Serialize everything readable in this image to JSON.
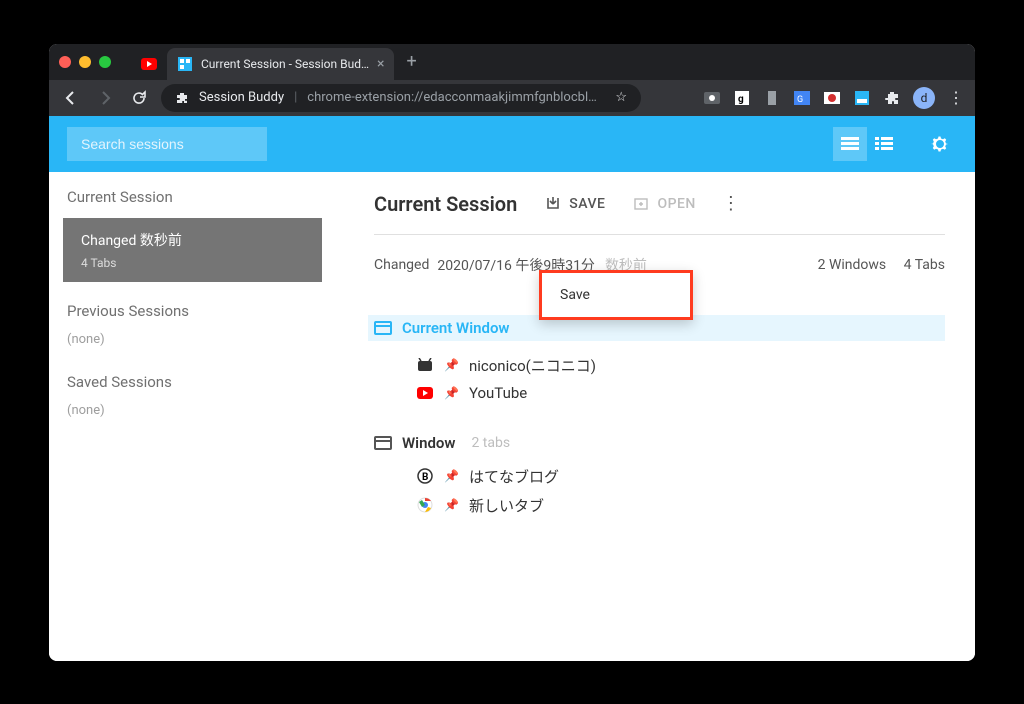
{
  "browser": {
    "tabs": [
      {
        "title": "",
        "icon": "youtube"
      },
      {
        "title": "Current Session - Session Bud…",
        "icon": "sessionbuddy",
        "active": true
      }
    ],
    "url_title": "Session Buddy",
    "url_path": "chrome-extension://edacconmaakjimmfgnblocbl…",
    "avatar_letter": "d"
  },
  "topbar": {
    "search_placeholder": "Search sessions"
  },
  "sidebar": {
    "current_heading": "Current Session",
    "current_item": {
      "line1": "Changed 数秒前",
      "line2": "4 Tabs"
    },
    "previous_heading": "Previous Sessions",
    "previous_none": "(none)",
    "saved_heading": "Saved Sessions",
    "saved_none": "(none)"
  },
  "main": {
    "title": "Current Session",
    "save_label": "SAVE",
    "open_label": "OPEN",
    "changed_label": "Changed",
    "changed_date": "2020/07/16 午後9時31分",
    "changed_relative": "数秒前",
    "windows_count": "2 Windows",
    "tabs_count": "4 Tabs"
  },
  "windows": [
    {
      "name": "Current Window",
      "active": true,
      "tabs_note": "",
      "tabs": [
        {
          "title": "niconico(ニコニコ)",
          "pinned": true,
          "icon": "nico"
        },
        {
          "title": "YouTube",
          "pinned": true,
          "icon": "youtube"
        }
      ]
    },
    {
      "name": "Window",
      "active": false,
      "tabs_note": "2 tabs",
      "tabs": [
        {
          "title": "はてなブログ",
          "pinned": true,
          "icon": "hatena"
        },
        {
          "title": "新しいタブ",
          "pinned": true,
          "icon": "chrome"
        }
      ]
    }
  ],
  "context_menu": {
    "items": [
      "Save"
    ]
  }
}
